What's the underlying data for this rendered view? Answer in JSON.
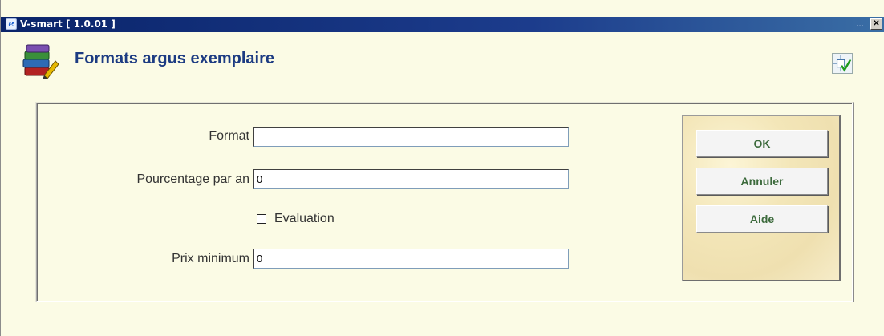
{
  "window": {
    "title": "V-smart [ 1.0.01 ]",
    "dots": "...",
    "close_label": "✕",
    "app_icon": "ie-icon"
  },
  "header": {
    "title": "Formats argus exemplaire",
    "icon": "books-icon",
    "corner_icon": "workflow-check-icon"
  },
  "form": {
    "format_label": "Format",
    "format_value": "",
    "pourcentage_label": "Pourcentage par an",
    "pourcentage_value": "0",
    "evaluation_label": "Evaluation",
    "evaluation_checked": false,
    "prix_label": "Prix minimum",
    "prix_value": "0"
  },
  "buttons": {
    "ok": "OK",
    "annuler": "Annuler",
    "aide": "Aide"
  },
  "colors": {
    "background": "#fbfbe5",
    "title": "#1c3b82",
    "button_text": "#3d6b3d",
    "titlebar": "#0a246a"
  }
}
